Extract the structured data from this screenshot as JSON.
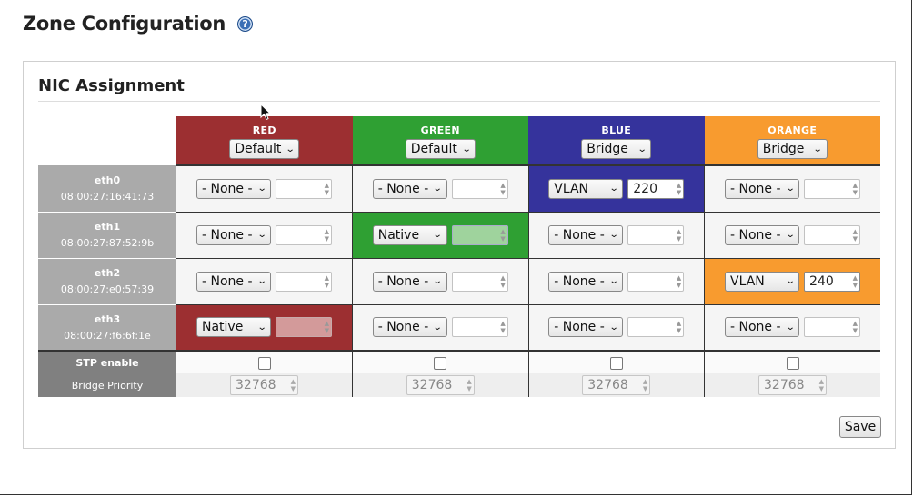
{
  "page": {
    "title": "Zone Configuration",
    "help_icon": "?"
  },
  "section": {
    "title": "NIC Assignment"
  },
  "colors": {
    "red": "#9c2f31",
    "green": "#2fa033",
    "blue": "#35339c",
    "orange": "#f89b2f",
    "nic_label_bg": "#aaaaaa",
    "stp_label_bg": "#808080"
  },
  "zones": [
    {
      "name": "RED",
      "mode": "Default"
    },
    {
      "name": "GREEN",
      "mode": "Default"
    },
    {
      "name": "BLUE",
      "mode": "Bridge"
    },
    {
      "name": "ORANGE",
      "mode": "Bridge"
    }
  ],
  "nics": [
    {
      "name": "eth0",
      "mac": "08:00:27:16:41:73",
      "cells": [
        {
          "assign": "- None -",
          "vlan": ""
        },
        {
          "assign": "- None -",
          "vlan": ""
        },
        {
          "assign": "VLAN",
          "vlan": "220"
        },
        {
          "assign": "- None -",
          "vlan": ""
        }
      ]
    },
    {
      "name": "eth1",
      "mac": "08:00:27:87:52:9b",
      "cells": [
        {
          "assign": "- None -",
          "vlan": ""
        },
        {
          "assign": "Native",
          "vlan": ""
        },
        {
          "assign": "- None -",
          "vlan": ""
        },
        {
          "assign": "- None -",
          "vlan": ""
        }
      ]
    },
    {
      "name": "eth2",
      "mac": "08:00:27:e0:57:39",
      "cells": [
        {
          "assign": "- None -",
          "vlan": ""
        },
        {
          "assign": "- None -",
          "vlan": ""
        },
        {
          "assign": "- None -",
          "vlan": ""
        },
        {
          "assign": "VLAN",
          "vlan": "240"
        }
      ]
    },
    {
      "name": "eth3",
      "mac": "08:00:27:f6:6f:1e",
      "cells": [
        {
          "assign": "Native",
          "vlan": ""
        },
        {
          "assign": "- None -",
          "vlan": ""
        },
        {
          "assign": "- None -",
          "vlan": ""
        },
        {
          "assign": "- None -",
          "vlan": ""
        }
      ]
    }
  ],
  "stp": {
    "label": "STP enable",
    "checked": [
      false,
      false,
      false,
      false
    ]
  },
  "bridge_priority": {
    "label": "Bridge Priority",
    "values": [
      "32768",
      "32768",
      "32768",
      "32768"
    ]
  },
  "actions": {
    "save_label": "Save"
  }
}
